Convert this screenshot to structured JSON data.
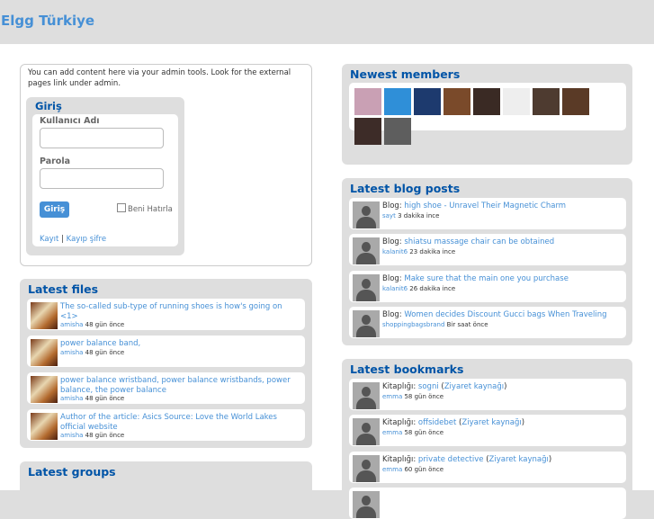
{
  "site": {
    "title": "Elgg Türkiye"
  },
  "intro": {
    "text": "You can add content here via your admin tools. Look for the external pages link under admin."
  },
  "login": {
    "title": "Giriş",
    "username_label": "Kullanıcı Adı",
    "username_value": "",
    "password_label": "Parola",
    "password_value": "",
    "submit_label": "Giriş",
    "remember_label": "Beni Hatırla",
    "register_link": "Kayıt",
    "separator": "|",
    "forgot_link": "Kayıp şifre"
  },
  "latest_files": {
    "title": "Latest files",
    "items": [
      {
        "title": "The so-called sub-type of running shoes is how's going on <1>",
        "user": "amisha",
        "time": "48 gün önce"
      },
      {
        "title": "power balance band,",
        "user": "amisha",
        "time": "48 gün önce"
      },
      {
        "title": "power balance wristband, power balance wristbands, power balance, the power balance",
        "user": "amisha",
        "time": "48 gün önce"
      },
      {
        "title": "Author of the article: Asics Source: Love the World Lakes official website",
        "user": "amisha",
        "time": "48 gün önce"
      }
    ]
  },
  "latest_groups": {
    "title": "Latest groups"
  },
  "newest_members": {
    "title": "Newest members",
    "avatars": [
      "avatar-1",
      "avatar-2",
      "avatar-3",
      "avatar-4",
      "avatar-5",
      "avatar-6",
      "avatar-7",
      "avatar-8",
      "avatar-9",
      "avatar-10"
    ],
    "colors": [
      "#c9a0b4",
      "#2f8fd8",
      "#1d3a6e",
      "#7a4a2a",
      "#3a2a24",
      "#eeeeee",
      "#4e3b30",
      "#5a3a26",
      "#3d2c28",
      "#5e5e5e"
    ]
  },
  "latest_blog_posts": {
    "title": "Latest blog posts",
    "prefix": "Blog:",
    "items": [
      {
        "title": "high shoe - Unravel Their Magnetic Charm",
        "user": "sayt",
        "time": "3 dakika ince"
      },
      {
        "title": "shiatsu massage chair can be obtained",
        "user": "kalanit6",
        "time": "23 dakika ince"
      },
      {
        "title": "Make sure that the main one you purchase",
        "user": "kalanit6",
        "time": "26 dakika ince"
      },
      {
        "title": "Women decides Discount Gucci bags When Traveling",
        "user": "shoppingbagsbrand",
        "time": "Bir saat önce"
      }
    ]
  },
  "latest_bookmarks": {
    "title": "Latest bookmarks",
    "prefix": "Kitaplığı:",
    "visit_label": "Ziyaret kaynağı",
    "items": [
      {
        "title": "sogni",
        "user": "emma",
        "time": "58 gün önce"
      },
      {
        "title": "offsidebet",
        "user": "emma",
        "time": "58 gün önce"
      },
      {
        "title": "private detective",
        "user": "emma",
        "time": "60 gün önce"
      }
    ]
  }
}
